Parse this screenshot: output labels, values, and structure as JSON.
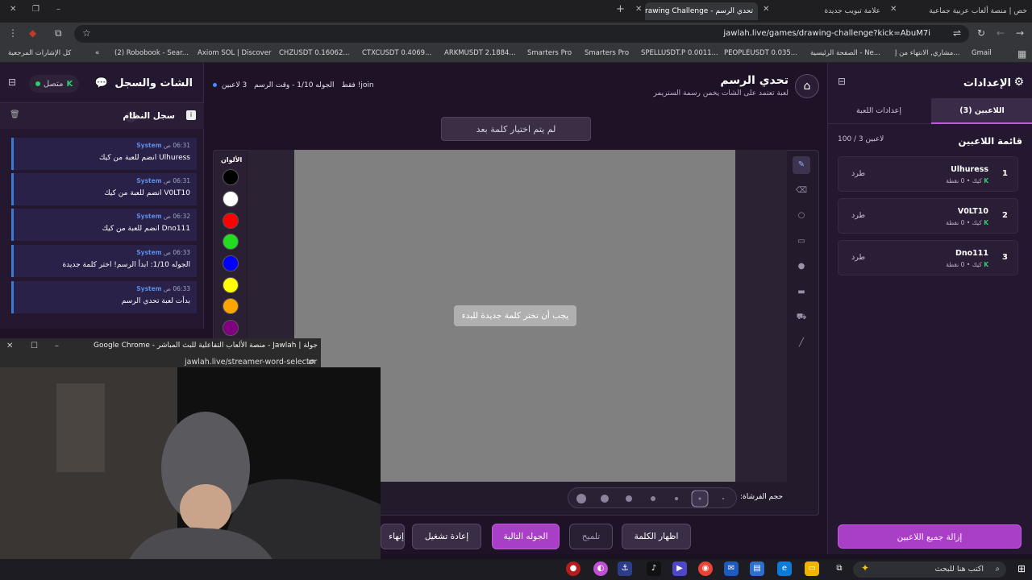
{
  "browser": {
    "tabs": [
      {
        "title": "خص | منصة ألعاب عربية جماعية"
      },
      {
        "title": "علامة تبويب جديدة"
      },
      {
        "title": "تحدي الرسم - Drawing Challenge"
      }
    ],
    "url": "jawlah.live/games/drawing-challenge?kick=AbuM7i",
    "bookmarks": [
      "Gmail",
      "مشاري, الانتهاء من إ...",
      "الصفحة الرئيسية - Ne...",
      "PEOPLEUSDT 0.035...",
      "SPELLUSDT.P 0.0011...",
      "Smarters Pro",
      "Smarters Pro",
      "ARKMUSDT 2.1884...",
      "CTXCUSDT 0.4069...",
      "CHZUSDT 0.16062...",
      "Axiom SOL | Discover",
      "(2) Robobook - Sear...",
      "كل الإشارات المرجعية"
    ]
  },
  "chat": {
    "title": "الشات والسجل",
    "status": "متصل",
    "syslog_title": "سجل النظام",
    "syslog_count": "7",
    "messages": [
      {
        "author": "System",
        "time": "06:31 ص",
        "text": "Ulhuress انضم للعبة من كيك"
      },
      {
        "author": "System",
        "time": "06:31 ص",
        "text": "V0LT10 انضم للعبة من كيك"
      },
      {
        "author": "System",
        "time": "06:32 ص",
        "text": "Dno111 انضم للعبة من كيك"
      },
      {
        "author": "System",
        "time": "06:33 ص",
        "text": "الجوله 1/10: ابدأ الرسم! اختر كلمة جديدة"
      },
      {
        "author": "System",
        "time": "06:33 ص",
        "text": "بدأت لعبة تحدي الرسم"
      }
    ]
  },
  "game": {
    "title": "تحدي الرسم",
    "subtitle": "لعبة تعتمد على الشات يخمن رسمة الستريمر",
    "players_online": "3 لاعبين",
    "round_info": "الجوله 1/10 - وقت الرسم",
    "join_hint": "join! فقط",
    "no_word": "لم يتم اختيار كلمة بعد",
    "colors_title": "الألوان",
    "colors": [
      "#000000",
      "#ffffff",
      "#ff0000",
      "#22dd22",
      "#0000ff",
      "#ffff00",
      "#ffa500",
      "#800080"
    ],
    "pick_message": "يجب أن تختر كلمة جديدة للبدء",
    "brush_label": "حجم الفرشاة:",
    "tools": [
      "pencil-icon",
      "eraser-icon",
      "circle-icon",
      "rectangle-icon",
      "filled-circle-icon",
      "filled-rect-icon",
      "fill-bucket-icon",
      "line-icon"
    ],
    "buttons": {
      "show_word": "اظهار الكلمة",
      "hint": "تلميح",
      "next_round": "الجوله التالية",
      "restart": "إعادة تشغيل",
      "end": "إنهاء"
    }
  },
  "settings": {
    "title": "الإعدادات",
    "tab_players": "اللاعبين (3)",
    "tab_game": "إعدادات اللعبة",
    "players_title": "قائمة اللاعبين",
    "players_count": "100 / 3 لاعبين",
    "kick_label": "طرد",
    "players": [
      {
        "rank": "1",
        "name": "Ulhuress",
        "meta": "كيك  •  0 نقطة"
      },
      {
        "rank": "2",
        "name": "V0LT10",
        "meta": "كيك  •  0 نقطة"
      },
      {
        "rank": "3",
        "name": "Dno111",
        "meta": "كيك  •  0 نقطة"
      }
    ],
    "remove_all": "إزالة جميع اللاعبين"
  },
  "popup": {
    "title": "جولة | Jawlah - منصة الألعاب التفاعلية للبث المباشر - Google Chrome",
    "url": "jawlah.live/streamer-word-selector"
  },
  "taskbar": {
    "search_placeholder": "اكتب هنا للبحث"
  },
  "colors": {
    "accent": "#a93fc7",
    "online": "#2ecc71",
    "system_blue": "#3b7bd6"
  }
}
